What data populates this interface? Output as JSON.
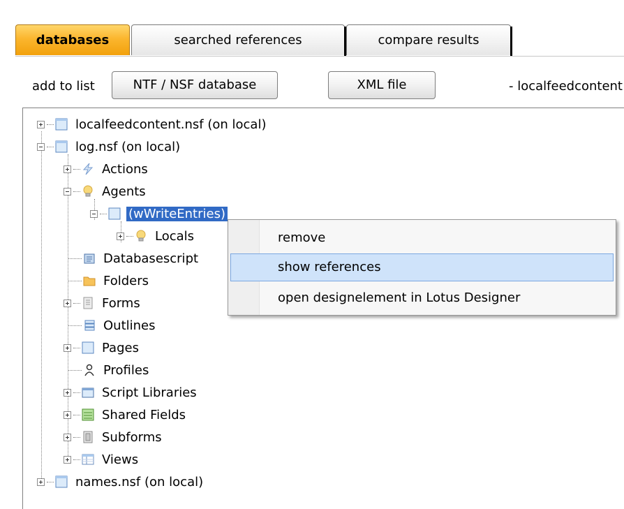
{
  "tabs": [
    {
      "label": "databases",
      "active": true
    },
    {
      "label": "searched references",
      "active": false
    },
    {
      "label": "compare results",
      "active": false
    }
  ],
  "toolbar": {
    "add_label": "add to list",
    "ntf_button": "NTF / NSF database",
    "xml_button": "XML file",
    "breadcrumb": "- localfeedcontent"
  },
  "tree": {
    "nodes": [
      {
        "label": "localfeedcontent.nsf (on local)",
        "icon": "database-icon",
        "expander": "plus"
      },
      {
        "label": "log.nsf (on local)",
        "icon": "database-icon",
        "expander": "minus"
      },
      {
        "label": "Actions",
        "icon": "lightning-icon",
        "expander": "plus"
      },
      {
        "label": "Agents",
        "icon": "lightbulb-icon",
        "expander": "minus"
      },
      {
        "label": "(wWriteEntries)",
        "icon": "agent-page-icon",
        "expander": "minus",
        "selected": true
      },
      {
        "label": "Locals",
        "icon": "lightbulb-icon",
        "expander": "plus"
      },
      {
        "label": "Databasescript",
        "icon": "script-icon",
        "expander": "none"
      },
      {
        "label": "Folders",
        "icon": "folder-icon",
        "expander": "none"
      },
      {
        "label": "Forms",
        "icon": "form-icon",
        "expander": "plus"
      },
      {
        "label": "Outlines",
        "icon": "outline-icon",
        "expander": "none"
      },
      {
        "label": "Pages",
        "icon": "page-icon",
        "expander": "plus"
      },
      {
        "label": "Profiles",
        "icon": "profile-icon",
        "expander": "none"
      },
      {
        "label": "Script Libraries",
        "icon": "library-icon",
        "expander": "plus"
      },
      {
        "label": "Shared Fields",
        "icon": "shared-fields-icon",
        "expander": "plus"
      },
      {
        "label": "Subforms",
        "icon": "subform-icon",
        "expander": "plus"
      },
      {
        "label": "Views",
        "icon": "view-icon",
        "expander": "plus"
      },
      {
        "label": "names.nsf (on local)",
        "icon": "database-icon",
        "expander": "plus"
      }
    ]
  },
  "context_menu": {
    "items": [
      {
        "label": "remove"
      },
      {
        "label": "show references",
        "highlighted": true
      },
      {
        "label": "open designelement in Lotus Designer"
      }
    ]
  },
  "colors": {
    "active_tab": "#f7a81b",
    "selection": "#316ac5",
    "menu_highlight": "#cfe3fa"
  }
}
